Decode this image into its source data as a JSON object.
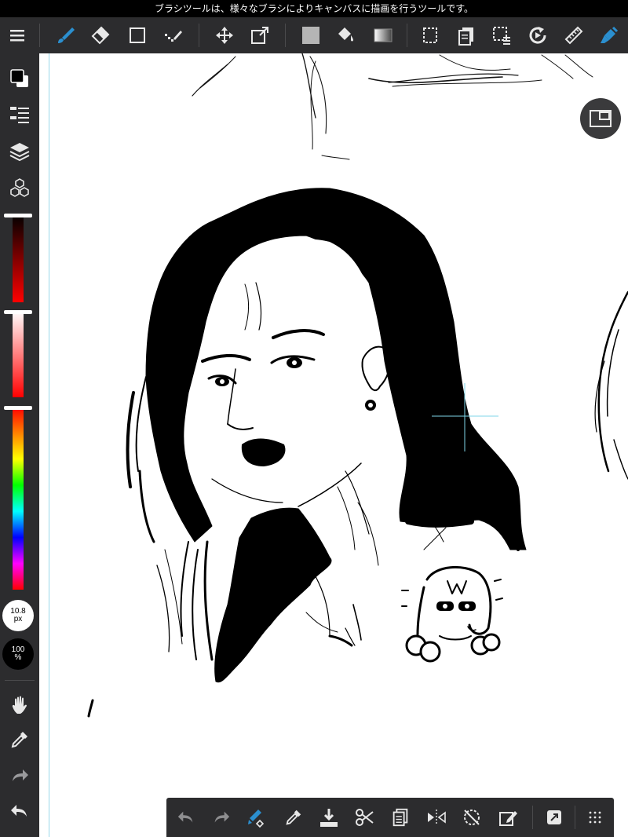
{
  "tooltip": {
    "text": "ブラシツールは、様々なブラシによりキャンバスに描画を行うツールです。"
  },
  "top_toolbar": {
    "tools": [
      {
        "icon": "brush-icon",
        "active": true
      },
      {
        "icon": "eraser-icon"
      },
      {
        "icon": "rectangle-shape-icon"
      },
      {
        "icon": "dotted-brush-icon"
      },
      {
        "icon": "move-icon"
      },
      {
        "icon": "transform-icon"
      },
      {
        "icon": "fill-color-swatch-icon"
      },
      {
        "icon": "bucket-icon"
      },
      {
        "icon": "gradient-icon"
      },
      {
        "icon": "select-icon"
      },
      {
        "icon": "copy-paste-icon"
      },
      {
        "icon": "select-layer-icon"
      },
      {
        "icon": "rotate-icon"
      },
      {
        "icon": "ruler-icon"
      },
      {
        "icon": "edge-brush-icon"
      }
    ]
  },
  "sidebar": {
    "brush_size": {
      "value": "10.8",
      "unit": "px"
    },
    "opacity": {
      "value": "100",
      "unit": "%"
    },
    "colors": {
      "foreground": "#000000",
      "background": "#ffffff"
    }
  },
  "bottom_toolbar": {
    "tools": [
      {
        "icon": "undo-icon"
      },
      {
        "icon": "redo-icon"
      },
      {
        "icon": "brush-color-swap-icon"
      },
      {
        "icon": "eyedropper-icon"
      },
      {
        "icon": "save-icon"
      },
      {
        "icon": "cut-icon"
      },
      {
        "icon": "copy-icon"
      },
      {
        "icon": "flip-horizontal-icon"
      },
      {
        "icon": "rotate-canvas-icon"
      },
      {
        "icon": "edit-icon"
      },
      {
        "icon": "share-icon"
      },
      {
        "icon": "more-icon"
      }
    ]
  },
  "theme": {
    "panel": "#2c2c2e",
    "accent": "#2b8fcf",
    "icon": "#e8e8e8",
    "guide": "#9ad8ea"
  }
}
